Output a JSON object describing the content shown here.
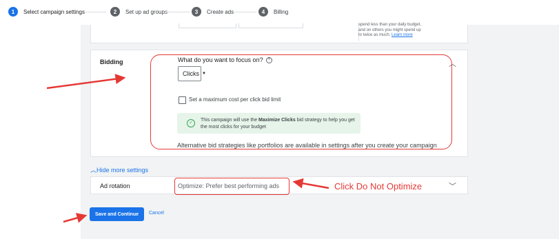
{
  "stepper": {
    "steps": [
      {
        "num": "1",
        "label": "Select campaign settings"
      },
      {
        "num": "2",
        "label": "Set up ad groups"
      },
      {
        "num": "3",
        "label": "Create ads"
      },
      {
        "num": "4",
        "label": "Billing"
      }
    ]
  },
  "budget_tip": {
    "line1": "spend less than your daily budget,",
    "line2": "and on others you might spend up",
    "line3": "to twice as much.",
    "link": "Learn more"
  },
  "bidding": {
    "section_label": "Bidding",
    "question": "What do you want to focus on?",
    "focus_value": "Clicks",
    "checkbox_label": "Set a maximum cost per click bid limit",
    "info_pre": "This campaign will use the ",
    "info_bold": "Maximize Clicks",
    "info_post": " bid strategy to help you get the most clicks for your budget",
    "alt_text": "Alternative bid strategies like portfolios are available in settings after you create your campaign"
  },
  "more_settings": {
    "toggle_label": "Hide more settings",
    "ad_rotation_label": "Ad rotation",
    "ad_rotation_value": "Optimize: Prefer best performing ads"
  },
  "actions": {
    "save_label": "Save and Continue",
    "cancel_label": "Cancel"
  },
  "annotation": {
    "text": "Click Do Not Optimize"
  },
  "colors": {
    "accent": "#1a73e8",
    "annotation_red": "#e53935",
    "info_bg": "#e6f4ea"
  }
}
